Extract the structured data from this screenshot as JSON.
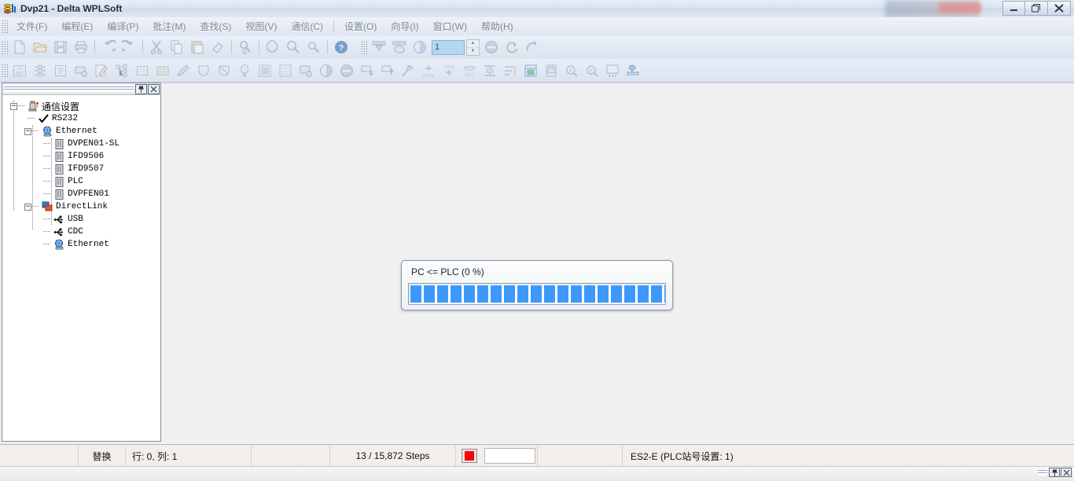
{
  "window": {
    "title": "Dvp21 - Delta WPLSoft",
    "icon": "delta-wplsoft-icon",
    "buttons": [
      {
        "name": "minimize-button",
        "glyph": "minimize"
      },
      {
        "name": "restore-button",
        "glyph": "restore"
      },
      {
        "name": "close-button",
        "glyph": "close"
      }
    ]
  },
  "menubar": {
    "items": [
      {
        "label": "文件(F)",
        "name": "menu-file"
      },
      {
        "label": "编程(E)",
        "name": "menu-program"
      },
      {
        "label": "编译(P)",
        "name": "menu-compile"
      },
      {
        "label": "批注(M)",
        "name": "menu-comment"
      },
      {
        "label": "查找(S)",
        "name": "menu-search"
      },
      {
        "label": "视图(V)",
        "name": "menu-view"
      },
      {
        "label": "通信(C)",
        "name": "menu-communication"
      },
      {
        "label": "设置(O)",
        "name": "menu-options"
      },
      {
        "label": "向导(I)",
        "name": "menu-wizard"
      },
      {
        "label": "窗口(W)",
        "name": "menu-window"
      },
      {
        "label": "帮助(H)",
        "name": "menu-help"
      }
    ]
  },
  "toolbar_main": {
    "spinner_value": "1",
    "icons": [
      "new-file-icon",
      "open-folder-icon",
      "save-icon",
      "print-icon",
      "undo-icon",
      "redo-icon",
      "cut-icon",
      "copy-icon",
      "paste-icon",
      "eraser-icon",
      "find-replace-icon",
      "zoom-icon",
      "zoom-in-icon",
      "zoom-out-icon",
      "help-icon",
      "download-to-plc-icon",
      "upload-from-plc-icon",
      "run-stop-icon",
      "stop-icon",
      "refresh-icon",
      "monitor-icon"
    ]
  },
  "toolbar_ladder": {
    "icons": [
      "ld-out-icon",
      "ladder-view-icon",
      "instruction-list-icon",
      "plc-comm-icon",
      "edit-comment-icon",
      "device-tree-icon",
      "device-table-icon",
      "register-table-icon",
      "pen-icon",
      "contact-a-icon",
      "contact-b-icon",
      "coil-icon",
      "block-icon",
      "block-table-icon",
      "monitor-plc-icon",
      "run-icon",
      "stop-icon",
      "write-to-plc-icon",
      "read-from-plc-icon",
      "program-compare-icon",
      "code-up-icon",
      "code-insert-icon",
      "bin-code-icon",
      "align-icon",
      "sort-icon",
      "ladder-grid-icon",
      "simulator-icon",
      "find-device-icon",
      "find-ip-icon",
      "monitor-table-icon",
      "status-monitor-icon"
    ]
  },
  "comm_panel": {
    "pin_icon": "pin-icon",
    "close_icon": "close-icon",
    "tree": [
      {
        "label": "通信设置",
        "icon": "comm-settings-icon",
        "indent": 0,
        "expander": "-",
        "cjk": true
      },
      {
        "label": "RS232",
        "icon": "check-icon",
        "indent": 1,
        "expander": "",
        "cjk": false
      },
      {
        "label": "Ethernet",
        "icon": "network-icon",
        "indent": 1,
        "expander": "-",
        "cjk": false
      },
      {
        "label": "DVPEN01-SL",
        "icon": "module-icon",
        "indent": 2,
        "expander": "",
        "cjk": false
      },
      {
        "label": "IFD9506",
        "icon": "module-icon",
        "indent": 2,
        "expander": "",
        "cjk": false
      },
      {
        "label": "IFD9507",
        "icon": "module-icon",
        "indent": 2,
        "expander": "",
        "cjk": false
      },
      {
        "label": "PLC",
        "icon": "module-icon",
        "indent": 2,
        "expander": "",
        "cjk": false
      },
      {
        "label": "DVPFEN01",
        "icon": "module-icon",
        "indent": 2,
        "expander": "",
        "cjk": false
      },
      {
        "label": "DirectLink",
        "icon": "directlink-icon",
        "indent": 1,
        "expander": "-",
        "cjk": false
      },
      {
        "label": "USB",
        "icon": "usb-icon",
        "indent": 2,
        "expander": "",
        "cjk": false
      },
      {
        "label": "CDC",
        "icon": "usb-icon",
        "indent": 2,
        "expander": "",
        "cjk": false
      },
      {
        "label": "Ethernet",
        "icon": "network-icon",
        "indent": 2,
        "expander": "",
        "cjk": false
      }
    ]
  },
  "progress_dialog": {
    "title": "PC <= PLC (0 %)",
    "percent": 0,
    "bar_color": "#3c99fb",
    "segments": 20
  },
  "statusbar": {
    "mode": "替换",
    "position": "行: 0, 列: 1",
    "steps": "13 / 15,872 Steps",
    "indicator_color": "#fd0000",
    "plc_model": "ES2-E (PLC站号设置: 1)"
  },
  "bottombar": {
    "pin_icon": "pin-icon",
    "close_icon": "close-icon"
  }
}
